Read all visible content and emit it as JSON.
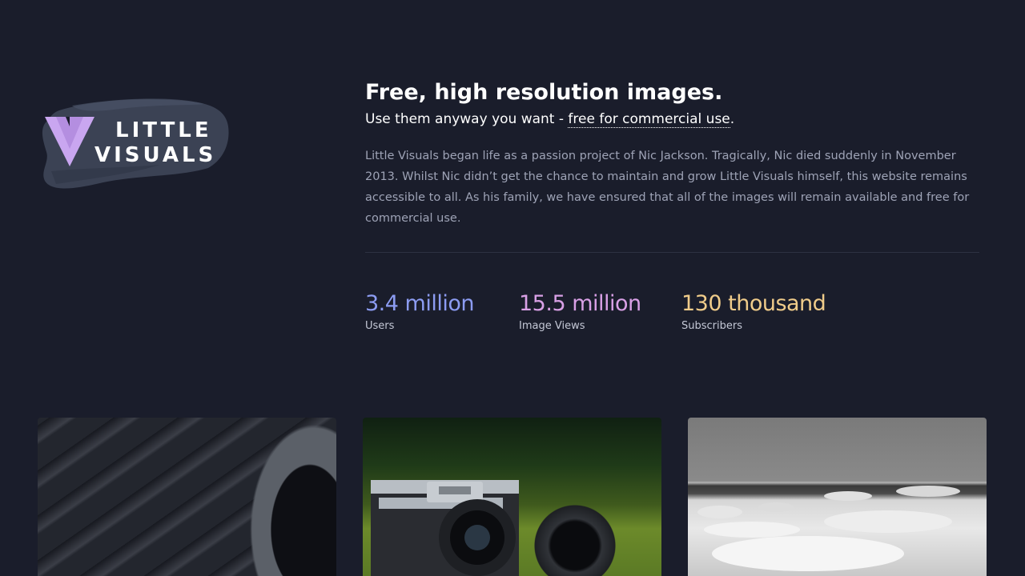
{
  "logo": {
    "line1": "LITTLE",
    "line2": "VISUALS",
    "mark_color": "#c9a6f0"
  },
  "hero": {
    "title": "Free, high resolution images.",
    "tagline_prefix": "Use them anyway you want - ",
    "tagline_link": "free for commercial use",
    "tagline_suffix": ".",
    "about": "Little Visuals began life as a passion project of Nic Jackson. Tragically, Nic died suddenly in November 2013. Whilst Nic didn’t get the chance to maintain and grow Little Visuals himself, this website remains accessible to all. As his family, we have ensured that all of the images will remain available and free for commercial use."
  },
  "stats": [
    {
      "value": "3.4 million",
      "label": "Users",
      "color": "#8c9cf2"
    },
    {
      "value": "15.5 million",
      "label": "Image Views",
      "color": "#d9a0e6"
    },
    {
      "value": "130 thousand",
      "label": "Subscribers",
      "color": "#f0cc8a"
    }
  ],
  "gallery": [
    {
      "name": "jet-engine-photo"
    },
    {
      "name": "canon-camera-photo"
    },
    {
      "name": "icy-shore-photo"
    }
  ],
  "colors": {
    "background": "#1a1d2b",
    "about_text": "#9ea3b6",
    "divider": "#2d3142"
  }
}
